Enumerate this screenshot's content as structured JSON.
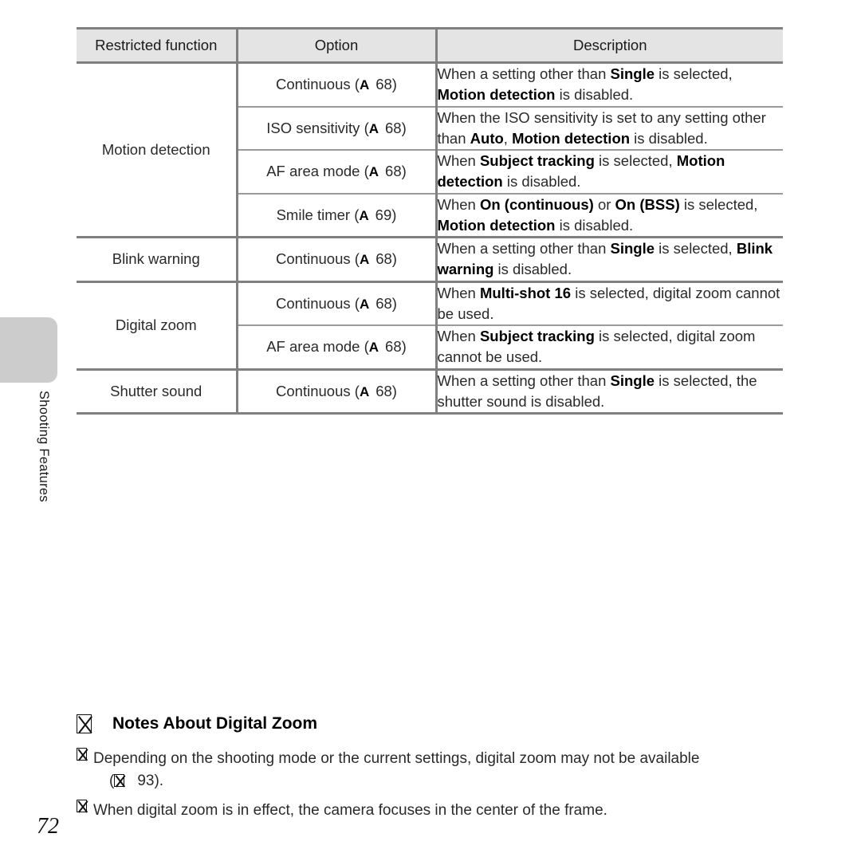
{
  "sidebar": {
    "section_label": "Shooting Features"
  },
  "page": {
    "number": "72"
  },
  "table": {
    "headers": {
      "function": "Restricted function",
      "option": "Option",
      "description": "Description"
    },
    "groups": [
      {
        "function": "Motion detection",
        "rows": [
          {
            "option_name": "Continuous",
            "option_mark": "A",
            "option_page": "68",
            "desc_parts": [
              {
                "t": "When a setting other than ",
                "b": false
              },
              {
                "t": "Single",
                "b": true
              },
              {
                "t": " is selected, ",
                "b": false
              },
              {
                "t": "Motion detection",
                "b": true
              },
              {
                "t": " is disabled.",
                "b": false
              }
            ]
          },
          {
            "option_name": "ISO sensitivity",
            "option_mark": "A",
            "option_page": "68",
            "desc_parts": [
              {
                "t": "When the ISO sensitivity is set to any setting other than ",
                "b": false
              },
              {
                "t": "Auto",
                "b": true
              },
              {
                "t": ", ",
                "b": false
              },
              {
                "t": "Motion detection",
                "b": true
              },
              {
                "t": " is disabled.",
                "b": false
              }
            ]
          },
          {
            "option_name": "AF area mode",
            "option_mark": "A",
            "option_page": "68",
            "desc_parts": [
              {
                "t": "When ",
                "b": false
              },
              {
                "t": "Subject tracking",
                "b": true
              },
              {
                "t": " is selected, ",
                "b": false
              },
              {
                "t": "Motion detection",
                "b": true
              },
              {
                "t": " is disabled.",
                "b": false
              }
            ]
          },
          {
            "option_name": "Smile timer",
            "option_mark": "A",
            "option_page": "69",
            "desc_parts": [
              {
                "t": "When ",
                "b": false
              },
              {
                "t": "On (continuous)",
                "b": true
              },
              {
                "t": " or ",
                "b": false
              },
              {
                "t": "On (BSS)",
                "b": true
              },
              {
                "t": " is selected, ",
                "b": false
              },
              {
                "t": "Motion detection",
                "b": true
              },
              {
                "t": " is disabled.",
                "b": false
              }
            ]
          }
        ]
      },
      {
        "function": "Blink warning",
        "rows": [
          {
            "option_name": "Continuous",
            "option_mark": "A",
            "option_page": "68",
            "desc_parts": [
              {
                "t": "When a setting other than ",
                "b": false
              },
              {
                "t": "Single",
                "b": true
              },
              {
                "t": " is selected, ",
                "b": false
              },
              {
                "t": "Blink warning",
                "b": true
              },
              {
                "t": " is disabled.",
                "b": false
              }
            ]
          }
        ]
      },
      {
        "function": "Digital zoom",
        "rows": [
          {
            "option_name": "Continuous",
            "option_mark": "A",
            "option_page": "68",
            "desc_parts": [
              {
                "t": "When ",
                "b": false
              },
              {
                "t": "Multi-shot 16",
                "b": true
              },
              {
                "t": " is selected, digital zoom cannot be used.",
                "b": false
              }
            ]
          },
          {
            "option_name": "AF area mode",
            "option_mark": "A",
            "option_page": "68",
            "desc_parts": [
              {
                "t": "When ",
                "b": false
              },
              {
                "t": "Subject tracking",
                "b": true
              },
              {
                "t": " is selected, digital zoom cannot be used.",
                "b": false
              }
            ]
          }
        ]
      },
      {
        "function": "Shutter sound",
        "rows": [
          {
            "option_name": "Continuous",
            "option_mark": "A",
            "option_page": "68",
            "desc_parts": [
              {
                "t": "When a setting other than ",
                "b": false
              },
              {
                "t": "Single",
                "b": true
              },
              {
                "t": " is selected, the shutter sound is disabled.",
                "b": false
              }
            ]
          }
        ]
      }
    ]
  },
  "notes": {
    "heading_icon": "missing-glyph-box-icon",
    "heading": "Notes About Digital Zoom",
    "items": [
      {
        "bullet_icon": "missing-glyph-box-icon",
        "text": "Depending on the shooting mode or the current settings, digital zoom may not be available",
        "sub_prefix": "(",
        "sub_page": "93",
        "sub_suffix": ")."
      },
      {
        "bullet_icon": "missing-glyph-box-icon",
        "text": "When digital zoom is in effect, the camera focuses in the center of the frame.",
        "sub_prefix": "",
        "sub_page": "",
        "sub_suffix": ""
      }
    ]
  }
}
